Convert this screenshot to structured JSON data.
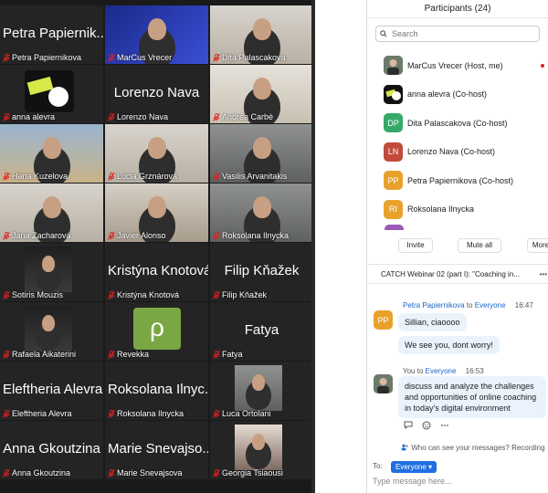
{
  "gallery": {
    "tiles": [
      {
        "name": "Petra Papiernikova",
        "big": "Petra Papiernik...",
        "type": "text"
      },
      {
        "name": "MarCus Vrecer",
        "type": "video",
        "scene": "dark-blue"
      },
      {
        "name": "Dita Palascakova",
        "type": "video",
        "scene": "light",
        "active": true
      },
      {
        "name": "anna alevra",
        "type": "logo"
      },
      {
        "name": "Lorenzo Nava",
        "big": "Lorenzo Nava",
        "type": "text"
      },
      {
        "name": "Andrea Carbè",
        "type": "video",
        "scene": "warm"
      },
      {
        "name": "Hana Kuzelova",
        "type": "video",
        "scene": "outdoor"
      },
      {
        "name": "Lucia Grznárová",
        "type": "video",
        "scene": "light"
      },
      {
        "name": "Vasilis Arvanitakis",
        "type": "video",
        "scene": "grey"
      },
      {
        "name": "Jana Zacharová",
        "type": "video",
        "scene": "light"
      },
      {
        "name": "Javier Alonso",
        "type": "video",
        "scene": "room"
      },
      {
        "name": "Roksolana Ilnycka",
        "type": "video",
        "scene": "grey"
      },
      {
        "name": "Sotiris Mouzis",
        "type": "photo",
        "scene": "dark"
      },
      {
        "name": "Kristýna Knotová",
        "big": "Kristýna Knotová",
        "type": "text"
      },
      {
        "name": "Filip Kňažek",
        "big": "Filip Kňažek",
        "type": "text"
      },
      {
        "name": "Rafaela Aikaterini",
        "type": "photo",
        "scene": "dark"
      },
      {
        "name": "Revekka",
        "type": "green-logo",
        "letter": "ρ"
      },
      {
        "name": "Fatya",
        "big": "Fatya",
        "type": "text"
      },
      {
        "name": "Eleftheria Alevra",
        "big": "Eleftheria Alevra",
        "type": "text"
      },
      {
        "name": "Roksolana Ilnycka",
        "big": "Roksolana Ilnyc...",
        "type": "text"
      },
      {
        "name": "Luca Ortolani",
        "type": "photo",
        "scene": "grey"
      },
      {
        "name": "Anna Gkoutzina",
        "big": "Anna Gkoutzina",
        "type": "text"
      },
      {
        "name": "Marie Snevajsova",
        "big": "Marie Snevajso...",
        "type": "text"
      },
      {
        "name": "Georgia Tsiaousi",
        "type": "photo",
        "scene": "portrait"
      }
    ]
  },
  "participants": {
    "title": "Participants (24)",
    "search_placeholder": "Search",
    "list": [
      {
        "name": "MarCus Vrecer (Host, me)",
        "initials": "",
        "color": "#4a4a4a",
        "photo": true,
        "recording": true
      },
      {
        "name": "anna alevra (Co-host)",
        "initials": "",
        "color": "#111111",
        "photo": true
      },
      {
        "name": "Dita Palascakova (Co-host)",
        "initials": "DP",
        "color": "#35a96a"
      },
      {
        "name": "Lorenzo Nava (Co-host)",
        "initials": "LN",
        "color": "#c24a3a"
      },
      {
        "name": "Petra Papiernikova (Co-host)",
        "initials": "PP",
        "color": "#e8a22c"
      },
      {
        "name": "Roksolana Ilnycka",
        "initials": "RI",
        "color": "#e8a22c"
      }
    ],
    "buttons": {
      "invite": "Invite",
      "mute_all": "Mute all",
      "more": "More"
    }
  },
  "chat": {
    "title": "CATCH Webinar 02 (part I): \"Coaching in...",
    "menu": "•••",
    "msg1": {
      "sender": "Petra Papiernikova",
      "to_word": "to",
      "recipient": "Everyone",
      "time": "16:47",
      "initials": "PP",
      "color": "#e8a22c",
      "lines": [
        "Sillian, ciaoooo",
        "We see you, dont worry!"
      ]
    },
    "msg2": {
      "sender": "You",
      "to_word": "to",
      "recipient": "Everyone",
      "time": "16:53",
      "text": "discuss and analyze the challenges and opportunities of online coaching in today's digital environment"
    },
    "who_can_see": "Who can see your messages? Recording",
    "to_label": "To:",
    "to_value": "Everyone",
    "input_placeholder": "Type message here..."
  },
  "colors": {
    "accent": "#1f6fe0",
    "active_border": "#33c04b",
    "tile_bg": "#242424",
    "muted_mic": "#e02020"
  }
}
